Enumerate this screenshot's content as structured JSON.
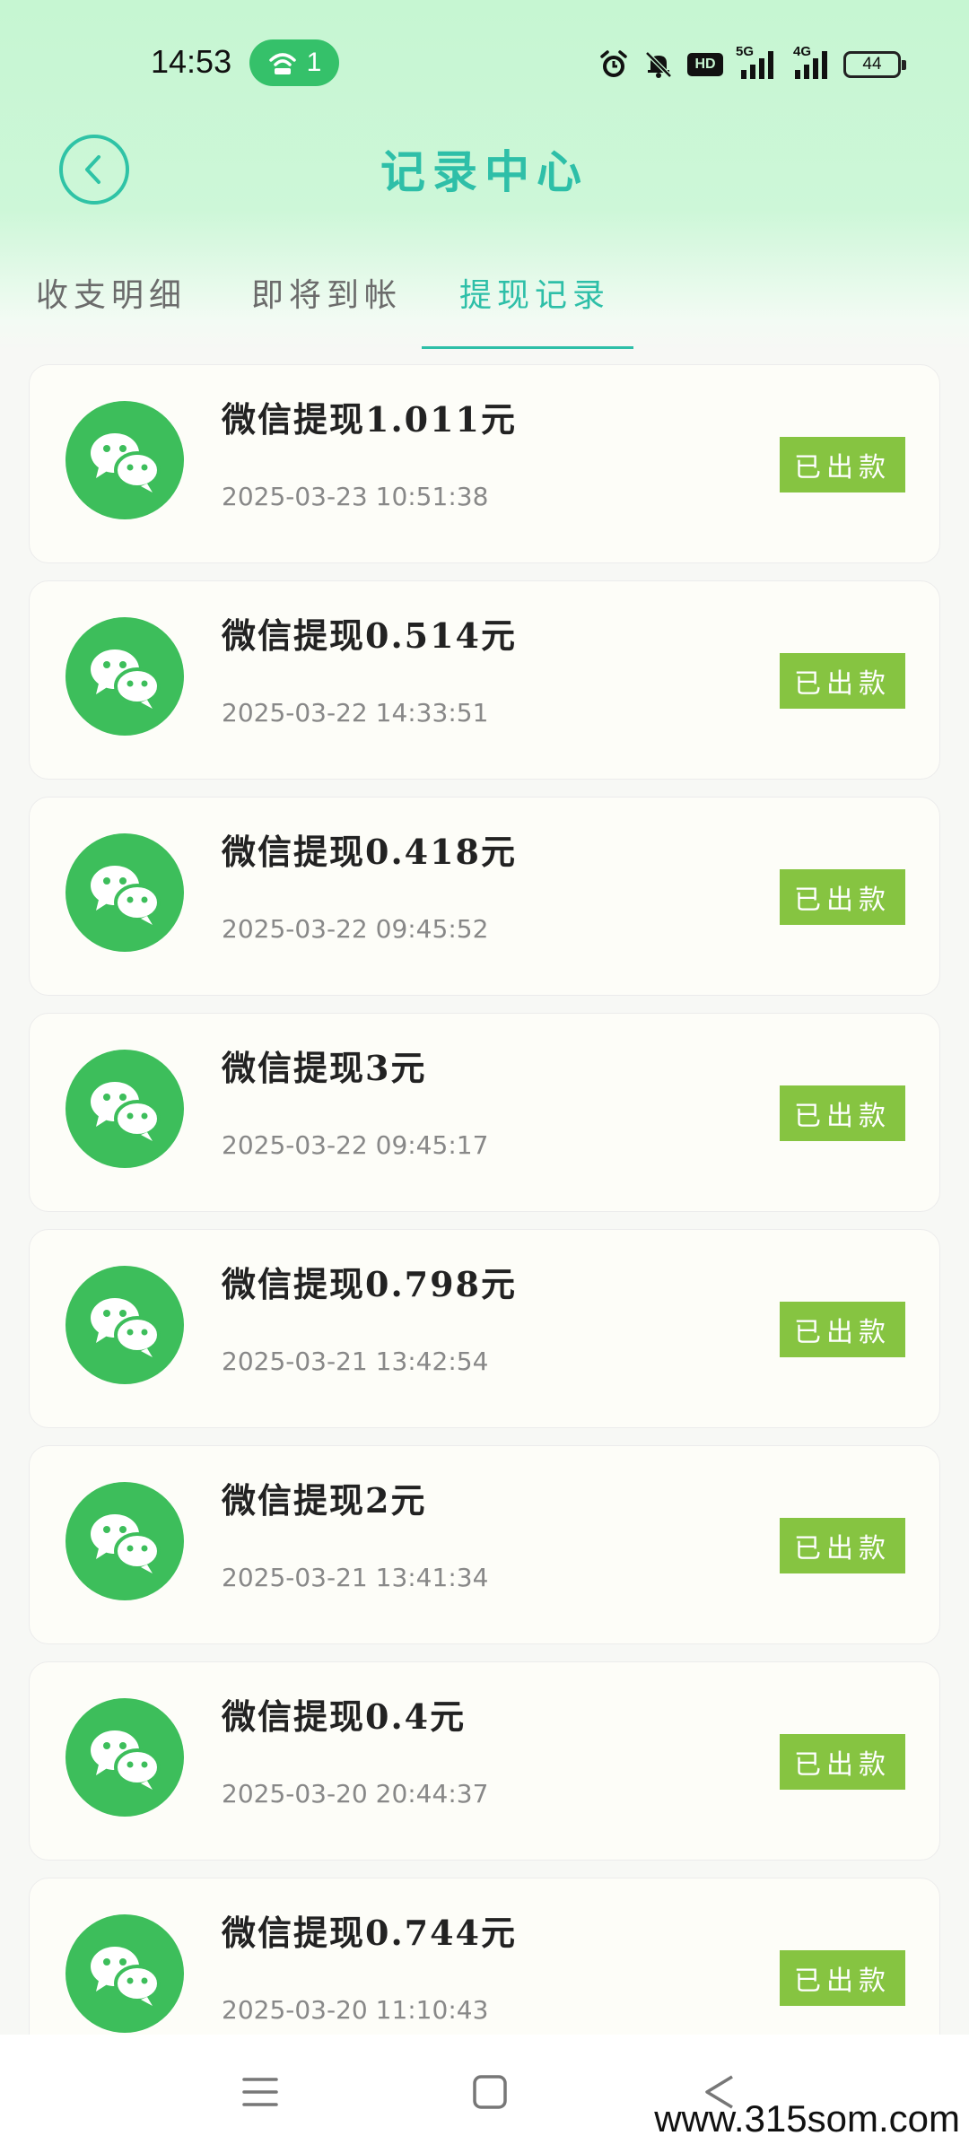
{
  "status_bar": {
    "time": "14:53",
    "hotspot_count": "1",
    "hd_label": "HD",
    "net1_label": "5G",
    "net2_label": "4G",
    "battery": "44"
  },
  "header": {
    "title": "记录中心"
  },
  "tabs": [
    {
      "label": "收支明细"
    },
    {
      "label": "即将到帐"
    },
    {
      "label": "提现记录"
    }
  ],
  "records": [
    {
      "title": "微信提现1.011元",
      "time": "2025-03-23 10:51:38",
      "status": "已出款"
    },
    {
      "title": "微信提现0.514元",
      "time": "2025-03-22 14:33:51",
      "status": "已出款"
    },
    {
      "title": "微信提现0.418元",
      "time": "2025-03-22 09:45:52",
      "status": "已出款"
    },
    {
      "title": "微信提现3元",
      "time": "2025-03-22 09:45:17",
      "status": "已出款"
    },
    {
      "title": "微信提现0.798元",
      "time": "2025-03-21 13:42:54",
      "status": "已出款"
    },
    {
      "title": "微信提现2元",
      "time": "2025-03-21 13:41:34",
      "status": "已出款"
    },
    {
      "title": "微信提现0.4元",
      "time": "2025-03-20 20:44:37",
      "status": "已出款"
    },
    {
      "title": "微信提现0.744元",
      "time": "2025-03-20 11:10:43",
      "status": "已出款"
    }
  ],
  "watermark": "www.315som.com",
  "colors": {
    "accent": "#2ebfa8",
    "wechat_green": "#3dbe5b",
    "badge_green": "#86c441"
  }
}
